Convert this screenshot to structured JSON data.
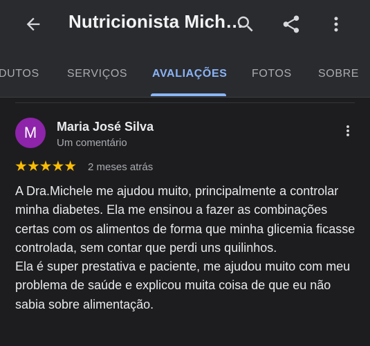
{
  "header": {
    "title": "Nutricionista Mich…",
    "icons": [
      "back-arrow-icon",
      "search-icon",
      "share-icon",
      "more-vert-icon"
    ]
  },
  "tabs": [
    {
      "label": "DUTOS",
      "active": false
    },
    {
      "label": "SERVIÇOS",
      "active": false
    },
    {
      "label": "AVALIAÇÕES",
      "active": true
    },
    {
      "label": "FOTOS",
      "active": false
    },
    {
      "label": "SOBRE",
      "active": false
    }
  ],
  "review": {
    "avatar_letter": "M",
    "avatar_color": "#8e24aa",
    "name": "Maria José Silva",
    "meta": "Um comentário",
    "rating": 5,
    "stars": "★★★★★",
    "time": "2 meses atrás",
    "paragraphs": [
      "A Dra.Michele me ajudou muito, principalmente a controlar minha diabetes. Ela me ensinou a fazer as combinações certas com os alimentos de forma que minha glicemia ficasse controlada, sem contar que perdi uns quilinhos.",
      "Ela é super prestativa e paciente, me ajudou muito com meu problema de saúde e explicou muita coisa de que eu não sabia sobre alimentação."
    ]
  },
  "colors": {
    "background": "#1d1d1f",
    "bar": "#2a2b2e",
    "accent": "#8ab4f8",
    "star": "#fbbc04"
  }
}
